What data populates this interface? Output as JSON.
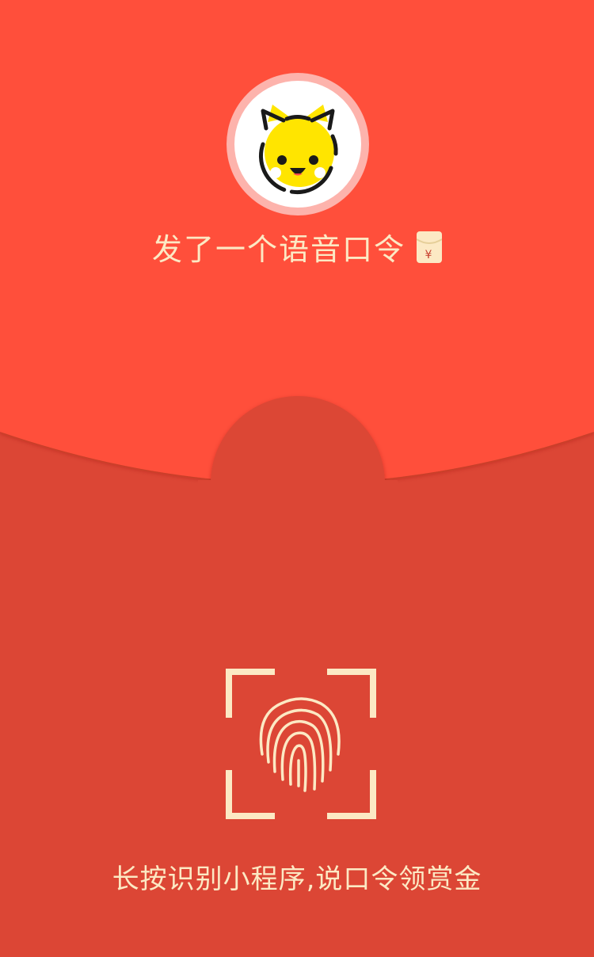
{
  "headline": {
    "text": "发了一个语音口令",
    "icon": "red-envelope-icon"
  },
  "envelope_icon": {
    "symbol": "¥"
  },
  "avatar": {
    "icon": "cat-face-icon"
  },
  "fingerprint": {
    "icon": "fingerprint-icon"
  },
  "caption": {
    "text": "长按识别小程序,说口令领赏金"
  },
  "colors": {
    "top_red": "#FF4F3A",
    "bottom_red": "#DC4635",
    "cream": "#FCE9C4",
    "ring": "#FDB3AC",
    "cat_yellow": "#FFE500"
  }
}
